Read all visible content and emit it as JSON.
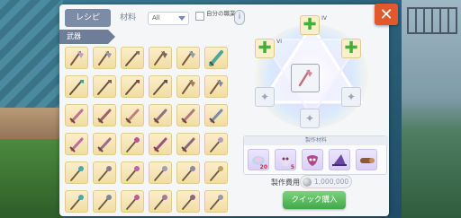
{
  "dialog": {
    "tabs": [
      {
        "label": "レシピ",
        "active": true
      },
      {
        "label": "材料",
        "active": false
      }
    ],
    "filter": {
      "selected": "All"
    },
    "own_only_label": "自分の職業",
    "info_icon": "i",
    "category_label": "武器",
    "close_icon": "✕"
  },
  "recipe_grid": {
    "items": [
      {
        "icon": "axe-icon",
        "color": "#c0a0c8"
      },
      {
        "icon": "axe-icon",
        "color": "#9a9aa8"
      },
      {
        "icon": "spear-icon",
        "color": "#8c7060"
      },
      {
        "icon": "axe-icon",
        "color": "#7a6a58"
      },
      {
        "icon": "axe-icon",
        "color": "#8aa0a8"
      },
      {
        "icon": "blade-icon",
        "color": "#4aa89a"
      },
      {
        "icon": "spear-icon",
        "color": "#3aa0a8"
      },
      {
        "icon": "spear-icon",
        "color": "#8a5a4a"
      },
      {
        "icon": "spear-icon",
        "color": "#9a3a3a"
      },
      {
        "icon": "spear-icon",
        "color": "#6a4a3a"
      },
      {
        "icon": "axe-icon",
        "color": "#a08060"
      },
      {
        "icon": "axe-icon",
        "color": "#8a8a9a"
      },
      {
        "icon": "sword-icon",
        "color": "#c07090"
      },
      {
        "icon": "sword-icon",
        "color": "#a06070"
      },
      {
        "icon": "sword-icon",
        "color": "#c08080"
      },
      {
        "icon": "sword-icon",
        "color": "#907080"
      },
      {
        "icon": "sword-icon",
        "color": "#b07a7a"
      },
      {
        "icon": "sword-icon",
        "color": "#7a8aa8"
      },
      {
        "icon": "sword-icon",
        "color": "#c06aa0"
      },
      {
        "icon": "sword-icon",
        "color": "#a06a8a"
      },
      {
        "icon": "staff-icon",
        "color": "#c050a0"
      },
      {
        "icon": "sword-icon",
        "color": "#a05080"
      },
      {
        "icon": "sword-icon",
        "color": "#8a6a7a"
      },
      {
        "icon": "staff-icon",
        "color": "#b0a0c0"
      },
      {
        "icon": "staff-icon",
        "color": "#4aa8b0"
      },
      {
        "icon": "staff-icon",
        "color": "#8a7a90"
      },
      {
        "icon": "staff-icon",
        "color": "#c060b0"
      },
      {
        "icon": "staff-icon",
        "color": "#a0a0b0"
      },
      {
        "icon": "staff-icon",
        "color": "#8a8aa0"
      },
      {
        "icon": "staff-icon",
        "color": "#c0a060"
      },
      {
        "icon": "staff-icon",
        "color": "#4aa8b0"
      },
      {
        "icon": "staff-icon",
        "color": "#7a8a9a"
      },
      {
        "icon": "staff-icon",
        "color": "#c05aa0"
      },
      {
        "icon": "staff-icon",
        "color": "#a07a9a"
      },
      {
        "icon": "staff-icon",
        "color": "#8a6a7a"
      },
      {
        "icon": "staff-icon",
        "color": "#9a9aa8"
      }
    ]
  },
  "upgrade": {
    "slots": [
      {
        "roman": "IV",
        "state": "plus"
      },
      {
        "roman": "VI",
        "state": "plus"
      },
      {
        "roman": "",
        "state": "plus"
      },
      {
        "roman": "",
        "state": "empty"
      },
      {
        "roman": "",
        "state": "empty"
      },
      {
        "roman": "",
        "state": "empty"
      }
    ],
    "center_item": {
      "icon": "axe-icon",
      "color": "#c07080"
    }
  },
  "materials": {
    "title": "製作材料",
    "items": [
      {
        "icon": "potion-icon",
        "count": "20"
      },
      {
        "icon": "skull-icon",
        "count": "5"
      },
      {
        "icon": "mask-icon",
        "count": ""
      },
      {
        "icon": "hat-icon",
        "count": ""
      },
      {
        "icon": "log-icon",
        "count": ""
      }
    ]
  },
  "cost": {
    "label": "製作費用:",
    "value": "1,000,000"
  },
  "buy_button": "クイック購入",
  "colors": {
    "accent": "#e0582c",
    "category": "#6f7e98",
    "buy": "#3fa84a"
  }
}
